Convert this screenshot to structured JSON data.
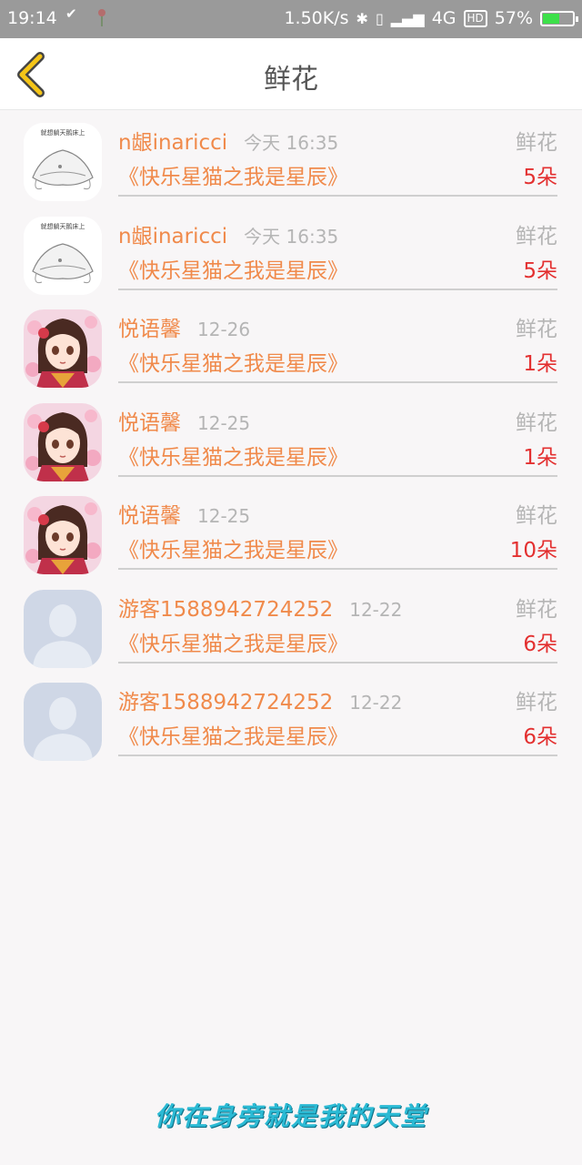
{
  "status_bar": {
    "time": "19:14",
    "net_speed": "1.50K/s",
    "network": "4G",
    "hd": "HD",
    "battery": "57%",
    "battery_level": 0.57
  },
  "header": {
    "title": "鲜花"
  },
  "gifts": [
    {
      "user": "n龈inaricci",
      "time": "今天 16:35",
      "label": "鲜花",
      "work": "《快乐星猫之我是星辰》",
      "count": "5朵",
      "avatar": "drawing"
    },
    {
      "user": "n龈inaricci",
      "time": "今天 16:35",
      "label": "鲜花",
      "work": "《快乐星猫之我是星辰》",
      "count": "5朵",
      "avatar": "drawing"
    },
    {
      "user": "悦语馨",
      "time": "12-26",
      "label": "鲜花",
      "work": "《快乐星猫之我是星辰》",
      "count": "1朵",
      "avatar": "anime-girl"
    },
    {
      "user": "悦语馨",
      "time": "12-25",
      "label": "鲜花",
      "work": "《快乐星猫之我是星辰》",
      "count": "1朵",
      "avatar": "anime-girl"
    },
    {
      "user": "悦语馨",
      "time": "12-25",
      "label": "鲜花",
      "work": "《快乐星猫之我是星辰》",
      "count": "10朵",
      "avatar": "anime-girl"
    },
    {
      "user": "游客1588942724252",
      "time": "12-22",
      "label": "鲜花",
      "work": "《快乐星猫之我是星辰》",
      "count": "6朵",
      "avatar": "default-person"
    },
    {
      "user": "游客1588942724252",
      "time": "12-22",
      "label": "鲜花",
      "work": "《快乐星猫之我是星辰》",
      "count": "6朵",
      "avatar": "default-person"
    }
  ],
  "footer": {
    "slogan": "你在身旁就是我的天堂"
  },
  "colors": {
    "accent_orange": "#f08a4b",
    "count_red": "#e33030",
    "back_arrow": "#f5c518",
    "slogan": "#2bbad4"
  }
}
